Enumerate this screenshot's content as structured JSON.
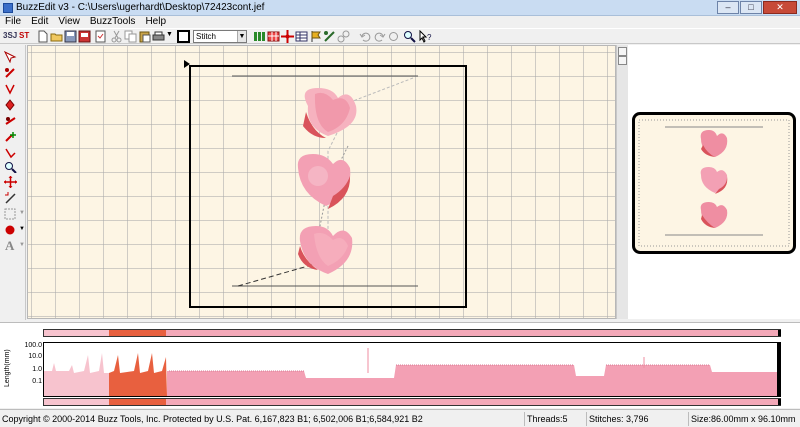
{
  "window": {
    "title": "BuzzEdit v3 - C:\\Users\\ugerhardt\\Desktop\\72423cont.jef",
    "minimize": "–",
    "maximize": "□",
    "close": "✕"
  },
  "menu": [
    "File",
    "Edit",
    "View",
    "BuzzTools",
    "Help"
  ],
  "toolbar": {
    "mode_a": "3SJ",
    "mode_b": "ST",
    "stitch_select_value": "Stitch",
    "dropdown_arrow": "▼"
  },
  "graph": {
    "y_axis_label": "Length(mm)",
    "y_ticks": [
      "100.0",
      "10.0",
      "1.0",
      "0.1"
    ]
  },
  "status": {
    "copyright": "Copyright © 2000-2014 Buzz Tools, Inc. Protected by U.S. Pat. 6,167,823 B1; 6,502,006 B1;6,584,921 B2",
    "threads": "Threads:5",
    "stitches": "Stitches: 3,796",
    "size": "Size:86.00mm x 96.10mm"
  },
  "colors": {
    "canvas": "#fdf5e4",
    "heart_light": "#f6b2bf",
    "heart_mid": "#ef8ea2",
    "heart_dark": "#d9535b",
    "stitch_pink": "#f3a0b4",
    "stitch_orange": "#e8603f"
  }
}
